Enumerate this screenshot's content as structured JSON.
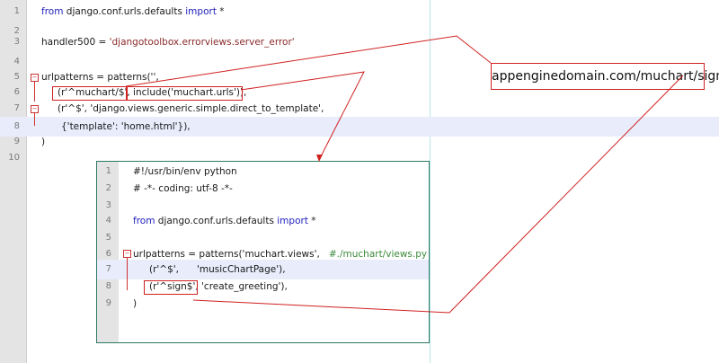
{
  "main_editor": {
    "lines": [
      {
        "num": "1",
        "a": "from",
        "b": " django.conf.urls.defaults ",
        "c": "import",
        "d": " *"
      },
      {
        "num": "2",
        "text": ""
      },
      {
        "num": "3",
        "a": "handler500 = ",
        "b": "'djangotoolbox.errorviews.server_error'"
      },
      {
        "num": "4",
        "text": ""
      },
      {
        "num": "5",
        "text": "urlpatterns = patterns('',"
      },
      {
        "num": "6",
        "a": "(r'^muchart/$', include('muchart.urls')),"
      },
      {
        "num": "7",
        "a": "(r'^$', 'django.views.generic.simple.direct_to_template',"
      },
      {
        "num": "8",
        "a": "{'template': 'home.html'}),"
      },
      {
        "num": "9",
        "text": ")"
      },
      {
        "num": "10",
        "text": ""
      }
    ]
  },
  "inset_editor": {
    "lines": [
      {
        "num": "1",
        "text": "#!/usr/bin/env python"
      },
      {
        "num": "2",
        "text": "# -*- coding: utf-8 -*-"
      },
      {
        "num": "3",
        "text": ""
      },
      {
        "num": "4",
        "a": "from",
        "b": " django.conf.urls.defaults ",
        "c": "import",
        "d": " *"
      },
      {
        "num": "5",
        "text": ""
      },
      {
        "num": "6",
        "a": "urlpatterns = patterns('muchart.views',",
        "b": "   #./muchart/views.py"
      },
      {
        "num": "7",
        "a": "(r'^$',      'musicChartPage'),"
      },
      {
        "num": "8",
        "a": "(r'^sign$', 'create_greeting'),"
      },
      {
        "num": "9",
        "text": ")"
      }
    ]
  },
  "callout": {
    "url": "appenginedomain.com/muchart/sign"
  },
  "colors": {
    "keyword": "#1e1ebe",
    "string": "#8a2a2a",
    "comment": "#3c8a3c",
    "annotation": "#d02020",
    "highlight": "#e8ecfb"
  }
}
